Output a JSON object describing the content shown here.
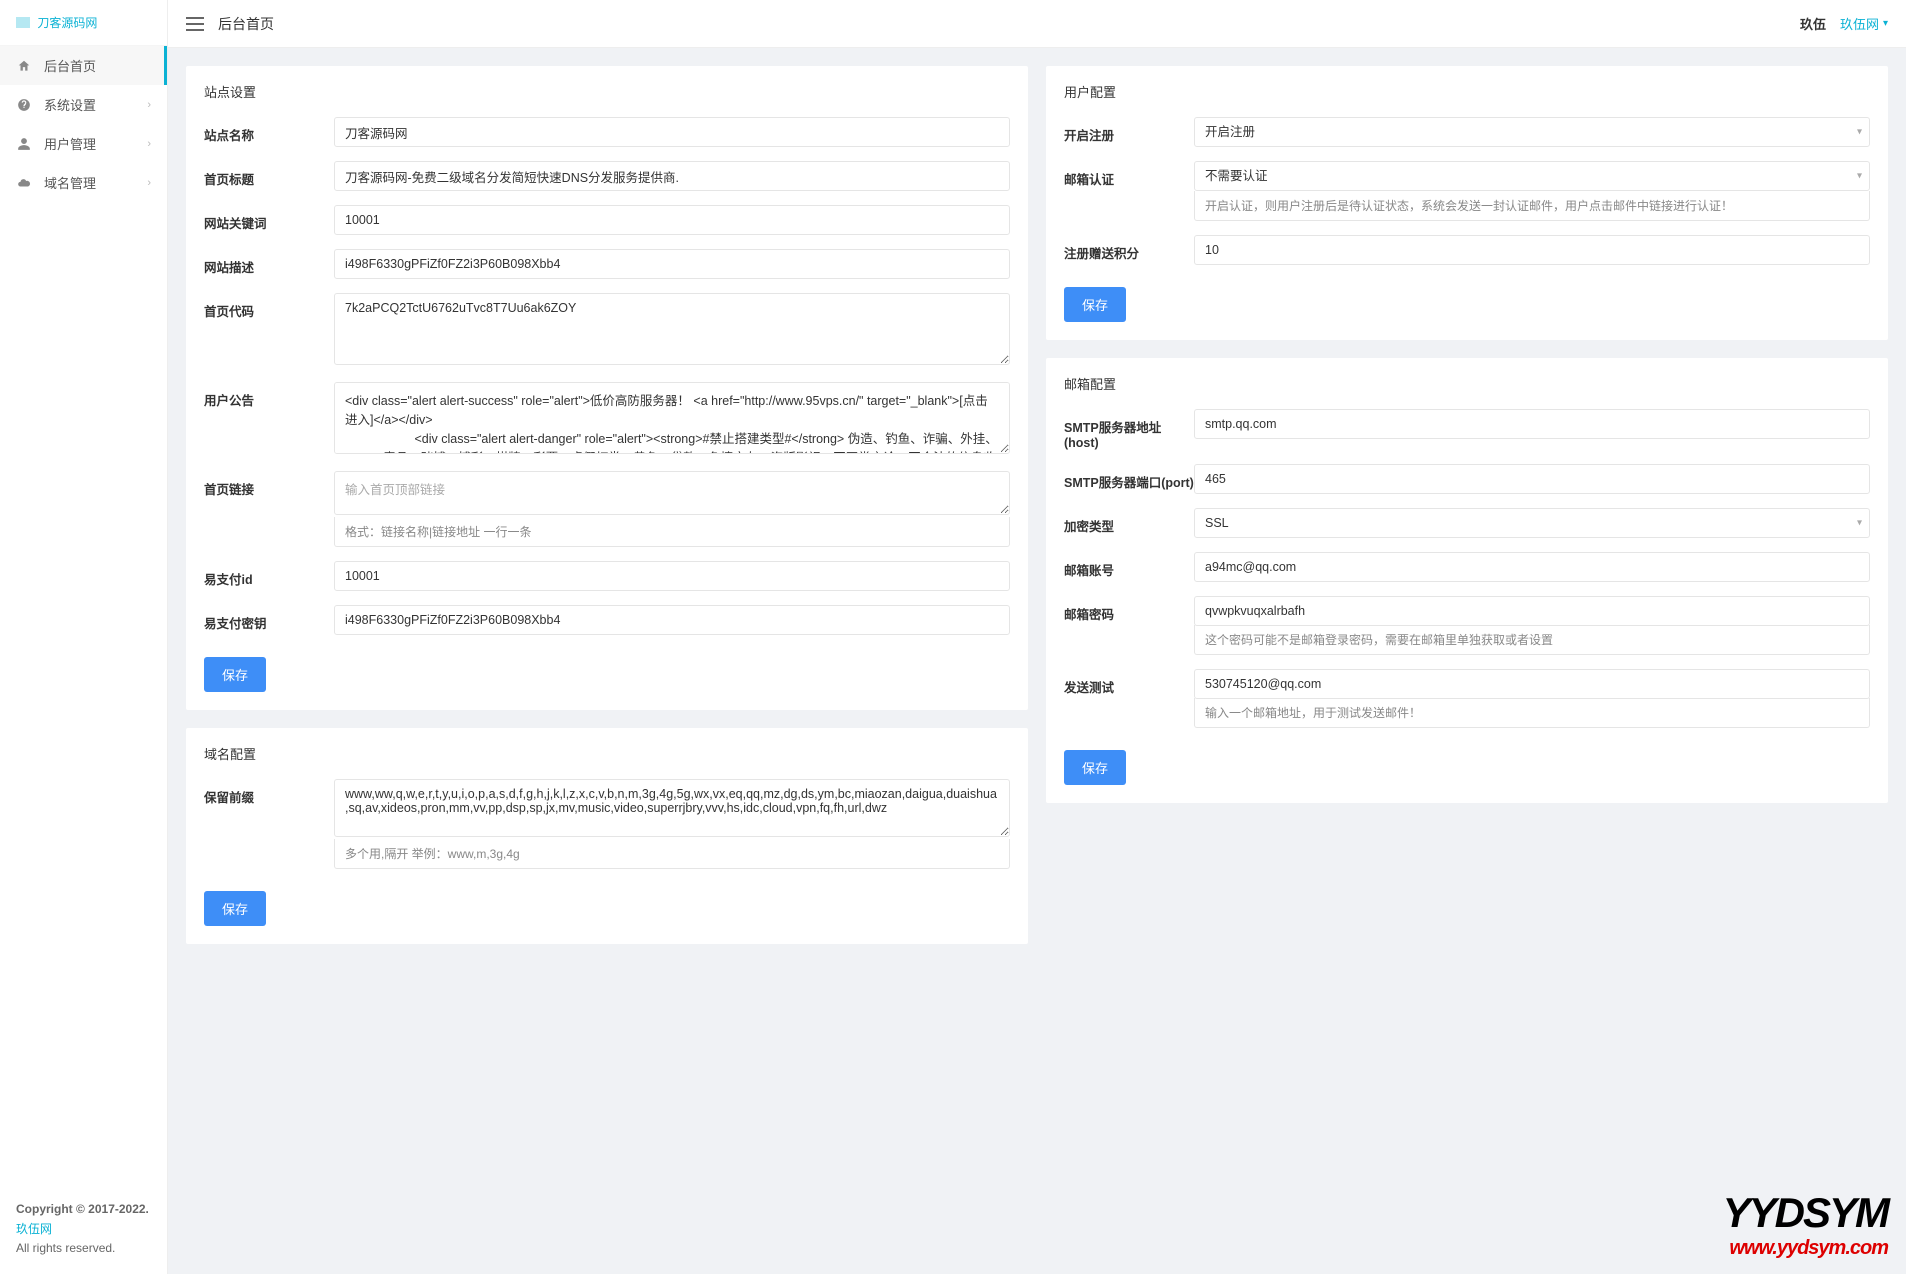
{
  "logo_text": "刀客源码网",
  "page_title": "后台首页",
  "topbar": {
    "user_raw": "玖伍",
    "user_link": "玖伍网"
  },
  "sidebar": {
    "items": [
      {
        "label": "后台首页",
        "icon": "home-icon",
        "active": true,
        "expandable": false
      },
      {
        "label": "系统设置",
        "icon": "dashboard-icon",
        "active": false,
        "expandable": true
      },
      {
        "label": "用户管理",
        "icon": "user-icon",
        "active": false,
        "expandable": true
      },
      {
        "label": "域名管理",
        "icon": "cloud-icon",
        "active": false,
        "expandable": true
      }
    ],
    "copyright_prefix": "Copyright © 2017-2022. ",
    "copyright_link": "玖伍网",
    "copyright_suffix": "All rights reserved."
  },
  "site_settings": {
    "title": "站点设置",
    "fields": {
      "site_name": {
        "label": "站点名称",
        "value": "刀客源码网"
      },
      "home_title": {
        "label": "首页标题",
        "value": "刀客源码网-免费二级域名分发简短快速DNS分发服务提供商."
      },
      "keywords": {
        "label": "网站关键词",
        "value": "10001"
      },
      "description": {
        "label": "网站描述",
        "value": "i498F6330gPFiZf0FZ2i3P60B098Xbb4"
      },
      "home_code": {
        "label": "首页代码",
        "value": "7k2aPCQ2TctU6762uTvc8T7Uu6ak6ZOY"
      },
      "announcement": {
        "label": "用户公告",
        "value": "<div class=\"alert alert-success\" role=\"alert\">低价高防服务器！ <a href=\"http://www.95vps.cn/\" target=\"_blank\">[点击进入]</a></div>\n                    <div class=\"alert alert-danger\" role=\"alert\"><strong>#禁止搭建类型#</strong> 伪造、钓鱼、诈骗、外挂、VPN、毒品、赌博、博彩、棋牌、彩票、虚假打赏、黄色、贷款、色情交友、盗版影视、不正常言论、不合法的信息收集、圈"
      },
      "home_links": {
        "label": "首页链接",
        "placeholder": "输入首页顶部链接",
        "help": "格式：链接名称|链接地址 一行一条"
      },
      "epay_id": {
        "label": "易支付id",
        "value": "10001"
      },
      "epay_key": {
        "label": "易支付密钥",
        "value": "i498F6330gPFiZf0FZ2i3P60B098Xbb4"
      }
    },
    "save": "保存"
  },
  "user_config": {
    "title": "用户配置",
    "fields": {
      "open_register": {
        "label": "开启注册",
        "value": "开启注册"
      },
      "email_verify": {
        "label": "邮箱认证",
        "value": "不需要认证",
        "help": "开启认证，则用户注册后是待认证状态，系统会发送一封认证邮件，用户点击邮件中链接进行认证！"
      },
      "bonus_points": {
        "label": "注册赠送积分",
        "value": "10"
      }
    },
    "save": "保存"
  },
  "mail_config": {
    "title": "邮箱配置",
    "fields": {
      "smtp_host": {
        "label": "SMTP服务器地址(host)",
        "value": "smtp.qq.com"
      },
      "smtp_port": {
        "label": "SMTP服务器端口(port)",
        "value": "465"
      },
      "encryption": {
        "label": "加密类型",
        "value": "SSL"
      },
      "mail_account": {
        "label": "邮箱账号",
        "value": "a94mc@qq.com"
      },
      "mail_password": {
        "label": "邮箱密码",
        "value": "qvwpkvuqxalrbafh",
        "help": "这个密码可能不是邮箱登录密码，需要在邮箱里单独获取或者设置"
      },
      "test_send": {
        "label": "发送测试",
        "value": "530745120@qq.com",
        "help": "输入一个邮箱地址，用于测试发送邮件！"
      }
    },
    "save": "保存"
  },
  "domain_config": {
    "title": "域名配置",
    "fields": {
      "reserved_prefix": {
        "label": "保留前缀",
        "value": "www,ww,q,w,e,r,t,y,u,i,o,p,a,s,d,f,g,h,j,k,l,z,x,c,v,b,n,m,3g,4g,5g,wx,vx,eq,qq,mz,dg,ds,ym,bc,miaozan,daigua,duaishua,sq,av,xideos,pron,mm,vv,pp,dsp,sp,jx,mv,music,video,superrjbry,vvv,hs,idc,cloud,vpn,fq,fh,url,dwz",
        "help": "多个用,隔开 举例：www,m,3g,4g"
      }
    },
    "save": "保存"
  },
  "watermark": {
    "line1": "YYDSYM",
    "line2": "www.yydsym.com"
  }
}
